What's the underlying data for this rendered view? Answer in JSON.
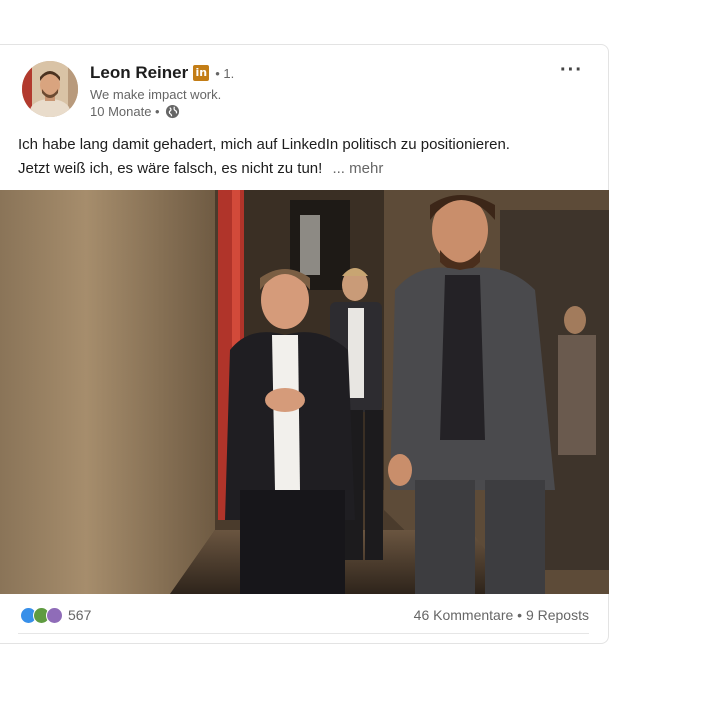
{
  "post": {
    "author": {
      "name": "Leon Reiner",
      "badge": "in",
      "degree": "• 1.",
      "tagline": "We make impact work.",
      "time": "10 Monate •"
    },
    "menu_label": "···",
    "text_line1": "Ich habe lang damit gehadert, mich auf LinkedIn politisch zu positionieren.",
    "text_line2": "Jetzt weiß ich, es wäre falsch, es nicht zu tun!",
    "see_more": "... mehr",
    "reactions": {
      "count": "567",
      "icons": [
        "like-icon",
        "celebrate-icon",
        "support-icon"
      ],
      "colors": [
        "#378fe9",
        "#5f9b41",
        "#8f6cb8"
      ]
    },
    "comments": "46 Kommentare",
    "separator": " • ",
    "reposts": "9 Reposts"
  }
}
